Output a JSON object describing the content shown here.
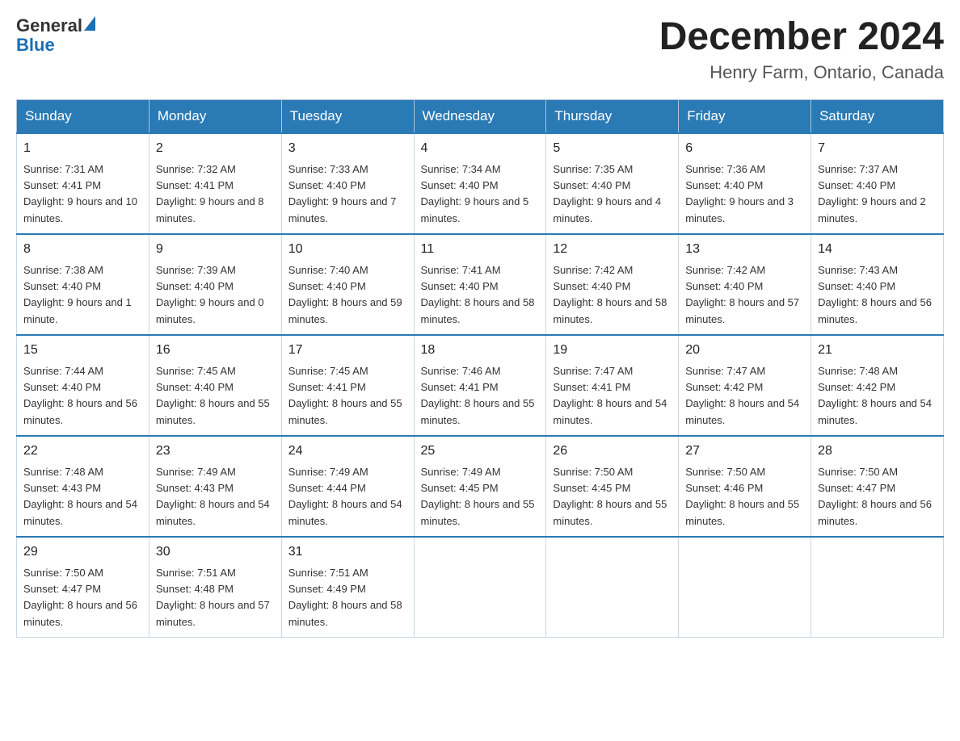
{
  "logo": {
    "general": "General",
    "blue": "Blue"
  },
  "title": "December 2024",
  "location": "Henry Farm, Ontario, Canada",
  "days_of_week": [
    "Sunday",
    "Monday",
    "Tuesday",
    "Wednesday",
    "Thursday",
    "Friday",
    "Saturday"
  ],
  "weeks": [
    [
      {
        "day": "1",
        "sunrise": "7:31 AM",
        "sunset": "4:41 PM",
        "daylight": "9 hours and 10 minutes."
      },
      {
        "day": "2",
        "sunrise": "7:32 AM",
        "sunset": "4:41 PM",
        "daylight": "9 hours and 8 minutes."
      },
      {
        "day": "3",
        "sunrise": "7:33 AM",
        "sunset": "4:40 PM",
        "daylight": "9 hours and 7 minutes."
      },
      {
        "day": "4",
        "sunrise": "7:34 AM",
        "sunset": "4:40 PM",
        "daylight": "9 hours and 5 minutes."
      },
      {
        "day": "5",
        "sunrise": "7:35 AM",
        "sunset": "4:40 PM",
        "daylight": "9 hours and 4 minutes."
      },
      {
        "day": "6",
        "sunrise": "7:36 AM",
        "sunset": "4:40 PM",
        "daylight": "9 hours and 3 minutes."
      },
      {
        "day": "7",
        "sunrise": "7:37 AM",
        "sunset": "4:40 PM",
        "daylight": "9 hours and 2 minutes."
      }
    ],
    [
      {
        "day": "8",
        "sunrise": "7:38 AM",
        "sunset": "4:40 PM",
        "daylight": "9 hours and 1 minute."
      },
      {
        "day": "9",
        "sunrise": "7:39 AM",
        "sunset": "4:40 PM",
        "daylight": "9 hours and 0 minutes."
      },
      {
        "day": "10",
        "sunrise": "7:40 AM",
        "sunset": "4:40 PM",
        "daylight": "8 hours and 59 minutes."
      },
      {
        "day": "11",
        "sunrise": "7:41 AM",
        "sunset": "4:40 PM",
        "daylight": "8 hours and 58 minutes."
      },
      {
        "day": "12",
        "sunrise": "7:42 AM",
        "sunset": "4:40 PM",
        "daylight": "8 hours and 58 minutes."
      },
      {
        "day": "13",
        "sunrise": "7:42 AM",
        "sunset": "4:40 PM",
        "daylight": "8 hours and 57 minutes."
      },
      {
        "day": "14",
        "sunrise": "7:43 AM",
        "sunset": "4:40 PM",
        "daylight": "8 hours and 56 minutes."
      }
    ],
    [
      {
        "day": "15",
        "sunrise": "7:44 AM",
        "sunset": "4:40 PM",
        "daylight": "8 hours and 56 minutes."
      },
      {
        "day": "16",
        "sunrise": "7:45 AM",
        "sunset": "4:40 PM",
        "daylight": "8 hours and 55 minutes."
      },
      {
        "day": "17",
        "sunrise": "7:45 AM",
        "sunset": "4:41 PM",
        "daylight": "8 hours and 55 minutes."
      },
      {
        "day": "18",
        "sunrise": "7:46 AM",
        "sunset": "4:41 PM",
        "daylight": "8 hours and 55 minutes."
      },
      {
        "day": "19",
        "sunrise": "7:47 AM",
        "sunset": "4:41 PM",
        "daylight": "8 hours and 54 minutes."
      },
      {
        "day": "20",
        "sunrise": "7:47 AM",
        "sunset": "4:42 PM",
        "daylight": "8 hours and 54 minutes."
      },
      {
        "day": "21",
        "sunrise": "7:48 AM",
        "sunset": "4:42 PM",
        "daylight": "8 hours and 54 minutes."
      }
    ],
    [
      {
        "day": "22",
        "sunrise": "7:48 AM",
        "sunset": "4:43 PM",
        "daylight": "8 hours and 54 minutes."
      },
      {
        "day": "23",
        "sunrise": "7:49 AM",
        "sunset": "4:43 PM",
        "daylight": "8 hours and 54 minutes."
      },
      {
        "day": "24",
        "sunrise": "7:49 AM",
        "sunset": "4:44 PM",
        "daylight": "8 hours and 54 minutes."
      },
      {
        "day": "25",
        "sunrise": "7:49 AM",
        "sunset": "4:45 PM",
        "daylight": "8 hours and 55 minutes."
      },
      {
        "day": "26",
        "sunrise": "7:50 AM",
        "sunset": "4:45 PM",
        "daylight": "8 hours and 55 minutes."
      },
      {
        "day": "27",
        "sunrise": "7:50 AM",
        "sunset": "4:46 PM",
        "daylight": "8 hours and 55 minutes."
      },
      {
        "day": "28",
        "sunrise": "7:50 AM",
        "sunset": "4:47 PM",
        "daylight": "8 hours and 56 minutes."
      }
    ],
    [
      {
        "day": "29",
        "sunrise": "7:50 AM",
        "sunset": "4:47 PM",
        "daylight": "8 hours and 56 minutes."
      },
      {
        "day": "30",
        "sunrise": "7:51 AM",
        "sunset": "4:48 PM",
        "daylight": "8 hours and 57 minutes."
      },
      {
        "day": "31",
        "sunrise": "7:51 AM",
        "sunset": "4:49 PM",
        "daylight": "8 hours and 58 minutes."
      },
      null,
      null,
      null,
      null
    ]
  ]
}
